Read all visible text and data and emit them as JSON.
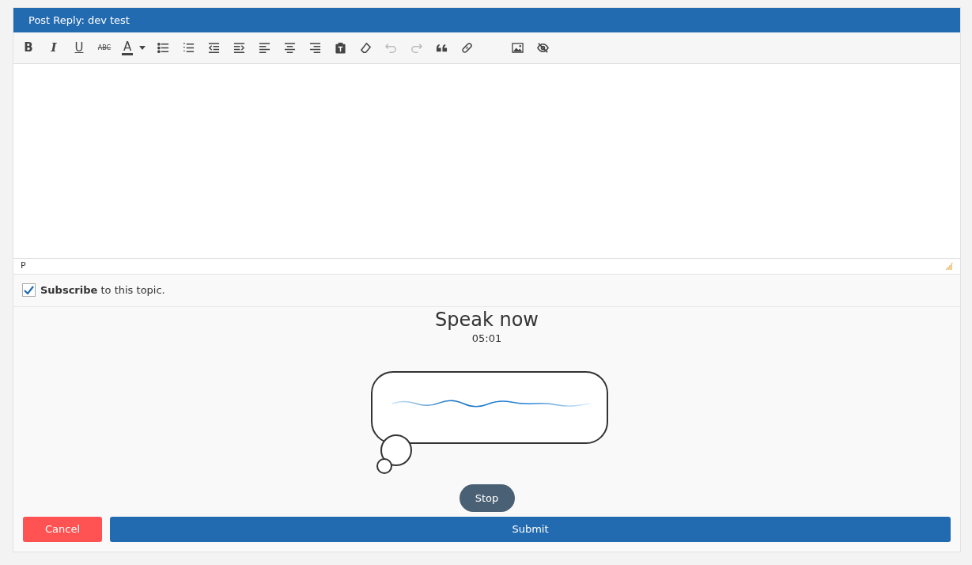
{
  "panel": {
    "title": "Post Reply: dev test"
  },
  "toolbar": [
    {
      "kind": "text",
      "label": "B",
      "disabled": false
    },
    {
      "kind": "text",
      "label": "I",
      "disabled": false
    },
    {
      "kind": "text",
      "label": "U",
      "disabled": false
    },
    {
      "kind": "text",
      "label": "ABC",
      "disabled": false
    },
    {
      "kind": "color",
      "label": "A",
      "disabled": false
    },
    {
      "kind": "icon",
      "disabled": false
    },
    {
      "kind": "icon",
      "disabled": false
    },
    {
      "kind": "icon",
      "disabled": false
    },
    {
      "kind": "icon",
      "disabled": false
    },
    {
      "kind": "icon",
      "disabled": false
    },
    {
      "kind": "icon",
      "disabled": false
    },
    {
      "kind": "icon",
      "disabled": false
    },
    {
      "kind": "icon",
      "disabled": false
    },
    {
      "kind": "icon",
      "disabled": false
    },
    {
      "kind": "icon",
      "disabled": true
    },
    {
      "kind": "icon",
      "disabled": true
    },
    {
      "kind": "icon",
      "disabled": false
    },
    {
      "kind": "icon",
      "disabled": false
    },
    {
      "kind": "gap"
    },
    {
      "kind": "icon",
      "disabled": false
    },
    {
      "kind": "icon",
      "disabled": false
    }
  ],
  "editor": {
    "path": "P"
  },
  "subscribe": {
    "checked": true,
    "text": "**Subscribe** to this topic."
  },
  "speech": {
    "title": "Speak now",
    "timer": "05:01",
    "stop": "Stop"
  },
  "buttons": [
    {
      "kind": "cancel",
      "label": "Cancel"
    },
    {
      "kind": "submit",
      "label": "Submit"
    }
  ]
}
